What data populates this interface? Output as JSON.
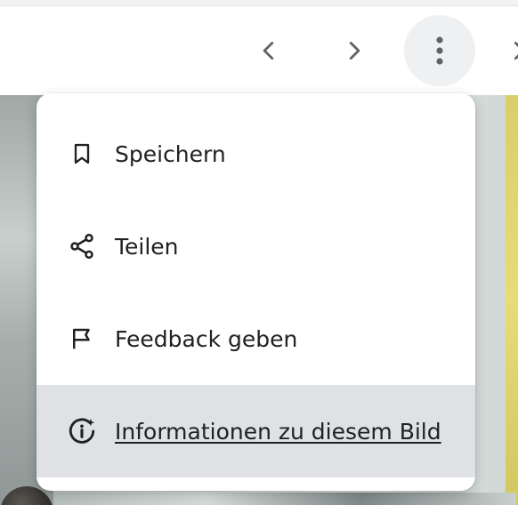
{
  "toolbar": {
    "buttons": [
      {
        "name": "previous",
        "icon": "chevron-left-icon"
      },
      {
        "name": "next",
        "icon": "chevron-right-icon"
      },
      {
        "name": "more-options",
        "icon": "more-vertical-icon",
        "active": true
      },
      {
        "name": "close",
        "icon": "close-icon"
      }
    ]
  },
  "menu": {
    "items": [
      {
        "label": "Speichern",
        "icon": "bookmark-icon"
      },
      {
        "label": "Teilen",
        "icon": "share-icon"
      },
      {
        "label": "Feedback geben",
        "icon": "flag-icon"
      },
      {
        "label": "Informationen zu diesem Bild",
        "icon": "info-sparkle-icon",
        "highlighted": true
      }
    ]
  },
  "colors": {
    "text": "#202124",
    "icon": "#5f6368",
    "menu_highlight": "#dfe1e5",
    "active_button_bg": "#eef0f2"
  }
}
